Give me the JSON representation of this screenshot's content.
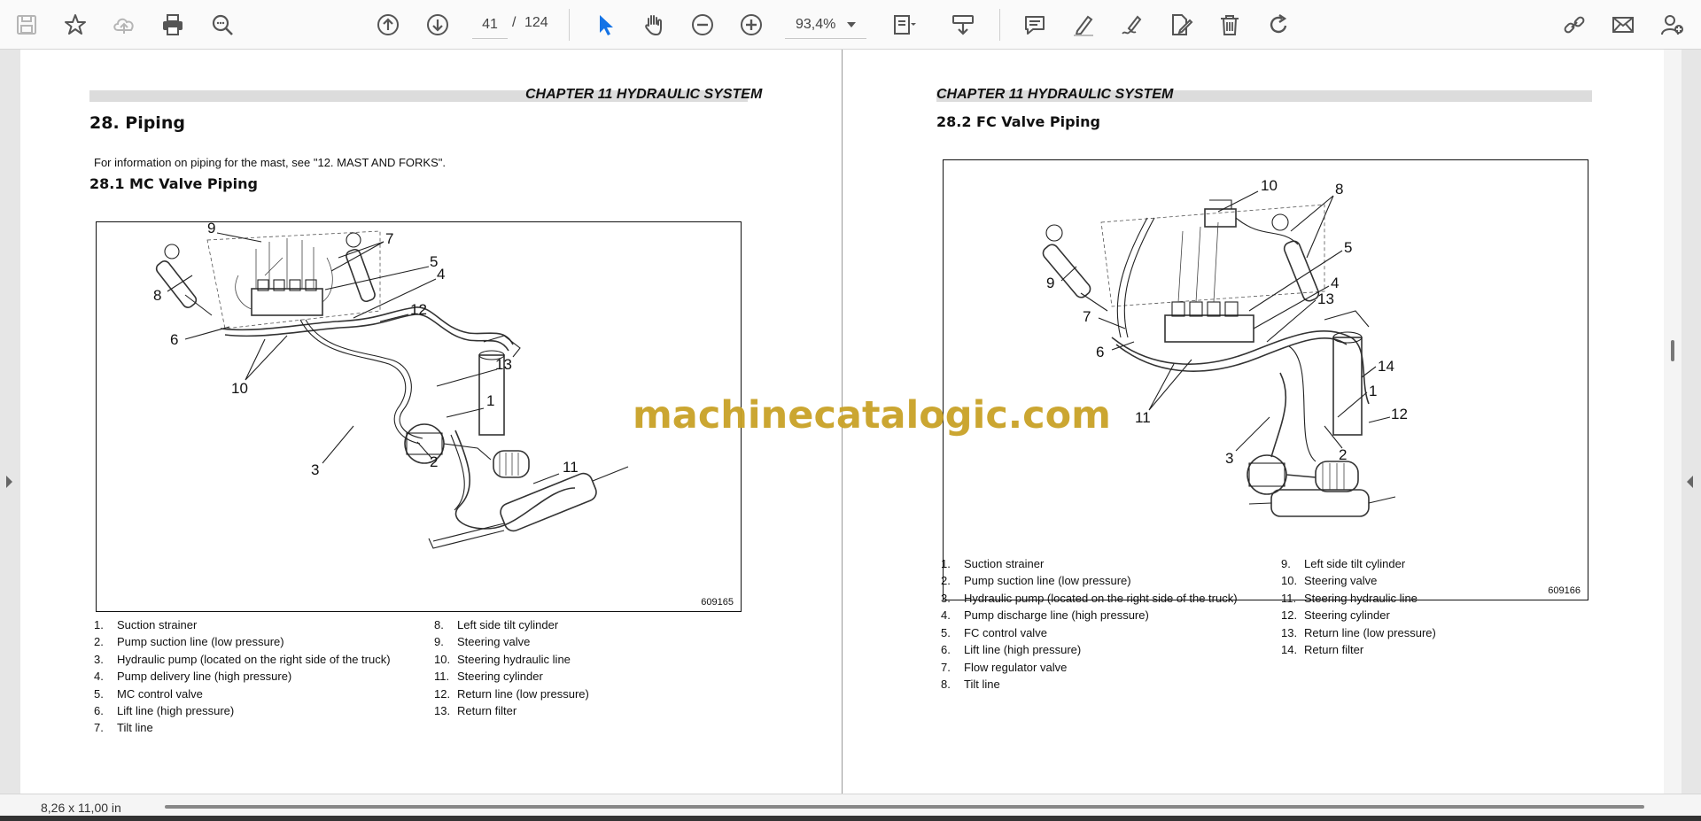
{
  "toolbar": {
    "icons": [
      "save-icon",
      "bookmark-star-icon",
      "cloud-upload-icon",
      "print-icon",
      "find-zoom-icon",
      "page-up-icon",
      "page-down-icon",
      "select-arrow-icon",
      "hand-tool-icon",
      "zoom-out-icon",
      "zoom-in-icon",
      "fit-page-icon",
      "scroll-mode-icon",
      "comment-icon",
      "highlight-pen-icon",
      "sign-pen-icon",
      "edit-doc-icon",
      "delete-icon",
      "rotate-icon",
      "share-link-icon",
      "mail-icon",
      "add-user-icon"
    ],
    "current_page": "41",
    "page_separator": "/",
    "total_pages": "124",
    "zoom": "93,4%",
    "accent_color": "#1473e6"
  },
  "left_page": {
    "chapter": "CHAPTER 11 HYDRAULIC SYSTEM",
    "heading": "28.  Piping",
    "intro": "For information on piping for the mast, see \"12. MAST AND FORKS\".",
    "subheading": "28.1    MC Valve Piping",
    "figure_number": "609165",
    "callouts": [
      "1",
      "2",
      "3",
      "4",
      "5",
      "6",
      "7",
      "8",
      "9",
      "10",
      "11",
      "12",
      "13",
      "10"
    ],
    "legend_left": [
      {
        "n": "1.",
        "text": "Suction strainer"
      },
      {
        "n": "2.",
        "text": "Pump suction line (low pressure)"
      },
      {
        "n": "3.",
        "text": "Hydraulic pump (located on the right side of the truck)"
      },
      {
        "n": "4.",
        "text": "Pump delivery line (high pressure)"
      },
      {
        "n": "5.",
        "text": "MC control valve"
      },
      {
        "n": "6.",
        "text": "Lift line (high pressure)"
      },
      {
        "n": "7.",
        "text": "Tilt line"
      }
    ],
    "legend_right": [
      {
        "n": "8.",
        "text": "Left side tilt cylinder"
      },
      {
        "n": "9.",
        "text": "Steering valve"
      },
      {
        "n": "10.",
        "text": "Steering hydraulic line"
      },
      {
        "n": "11.",
        "text": "Steering cylinder"
      },
      {
        "n": "12.",
        "text": "Return line (low pressure)"
      },
      {
        "n": "13.",
        "text": "Return filter"
      }
    ]
  },
  "right_page": {
    "chapter": "CHAPTER 11 HYDRAULIC SYSTEM",
    "subheading": "28.2    FC Valve Piping",
    "figure_number": "609166",
    "callouts": [
      "1",
      "2",
      "3",
      "4",
      "5",
      "6",
      "7",
      "8",
      "9",
      "10",
      "11",
      "12",
      "13",
      "14"
    ],
    "legend_left": [
      {
        "n": "1.",
        "text": "Suction strainer"
      },
      {
        "n": "2.",
        "text": "Pump suction line (low pressure)"
      },
      {
        "n": "3.",
        "text": "Hydraulic pump (located on the right side of the truck)"
      },
      {
        "n": "4.",
        "text": "Pump discharge line (high pressure)"
      },
      {
        "n": "5.",
        "text": "FC control valve"
      },
      {
        "n": "6.",
        "text": "Lift line (high pressure)"
      },
      {
        "n": "7.",
        "text": "Flow regulator valve"
      },
      {
        "n": "8.",
        "text": "Tilt line"
      }
    ],
    "legend_right": [
      {
        "n": "9.",
        "text": "Left side tilt cylinder"
      },
      {
        "n": "10.",
        "text": "Steering valve"
      },
      {
        "n": "11.",
        "text": "Steering hydraulic line"
      },
      {
        "n": "12.",
        "text": "Steering cylinder"
      },
      {
        "n": "13.",
        "text": "Return line (low pressure)"
      },
      {
        "n": "14.",
        "text": "Return filter"
      }
    ]
  },
  "watermark": "machinecatalogic.com",
  "watermark_color": "#c9a227",
  "status": {
    "page_size": "8,26 x 11,00 in"
  }
}
